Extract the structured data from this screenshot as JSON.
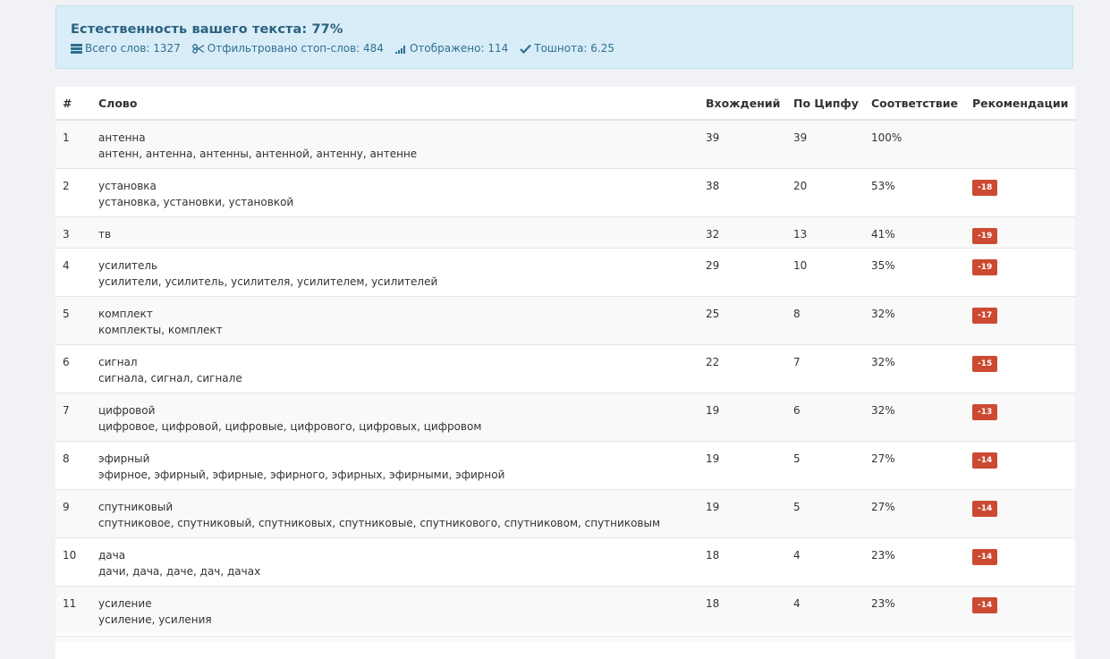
{
  "summary": {
    "title": "Естественность вашего текста: 77%",
    "stats": [
      {
        "icon": "list-icon",
        "label": "Всего слов: 1327"
      },
      {
        "icon": "scissors-icon",
        "label": "Отфильтровано стоп-слов: 484"
      },
      {
        "icon": "signal-bars-icon",
        "label": "Отображено: 114"
      },
      {
        "icon": "check-icon",
        "label": "Тошнота: 6.25"
      }
    ]
  },
  "table": {
    "headers": {
      "num": "#",
      "word": "Слово",
      "count": "Вхождений",
      "zipf": "По Ципфу",
      "match": "Соответствие",
      "rec": "Рекомендации"
    },
    "rows": [
      {
        "num": "1",
        "word": "антенна",
        "forms": "антенн, антенна, антенны, антенной, антенну, антенне",
        "count": "39",
        "zipf": "39",
        "match": "100%",
        "rec": ""
      },
      {
        "num": "2",
        "word": "установка",
        "forms": "установка, установки, установкой",
        "count": "38",
        "zipf": "20",
        "match": "53%",
        "rec": "-18"
      },
      {
        "num": "3",
        "word": "тв",
        "forms": "",
        "count": "32",
        "zipf": "13",
        "match": "41%",
        "rec": "-19"
      },
      {
        "num": "4",
        "word": "усилитель",
        "forms": "усилители, усилитель, усилителя, усилителем, усилителей",
        "count": "29",
        "zipf": "10",
        "match": "35%",
        "rec": "-19"
      },
      {
        "num": "5",
        "word": "комплект",
        "forms": "комплекты, комплект",
        "count": "25",
        "zipf": "8",
        "match": "32%",
        "rec": "-17"
      },
      {
        "num": "6",
        "word": "сигнал",
        "forms": "сигнала, сигнал, сигнале",
        "count": "22",
        "zipf": "7",
        "match": "32%",
        "rec": "-15"
      },
      {
        "num": "7",
        "word": "цифровой",
        "forms": "цифровое, цифровой, цифровые, цифрового, цифровых, цифровом",
        "count": "19",
        "zipf": "6",
        "match": "32%",
        "rec": "-13"
      },
      {
        "num": "8",
        "word": "эфирный",
        "forms": "эфирное, эфирный, эфирные, эфирного, эфирных, эфирными, эфирной",
        "count": "19",
        "zipf": "5",
        "match": "27%",
        "rec": "-14"
      },
      {
        "num": "9",
        "word": "спутниковый",
        "forms": "спутниковое, спутниковый, спутниковых, спутниковые, спутникового, спутниковом, спутниковым",
        "count": "19",
        "zipf": "5",
        "match": "27%",
        "rec": "-14"
      },
      {
        "num": "10",
        "word": "дача",
        "forms": "дачи, дача, даче, дач, дачах",
        "count": "18",
        "zipf": "4",
        "match": "23%",
        "rec": "-14"
      },
      {
        "num": "11",
        "word": "усиление",
        "forms": "усиление, усиления",
        "count": "18",
        "zipf": "4",
        "match": "23%",
        "rec": "-14"
      }
    ]
  },
  "colors": {
    "alert_bg": "#d8edf7",
    "alert_text": "#2b6180",
    "badge": "#cc4a32"
  }
}
